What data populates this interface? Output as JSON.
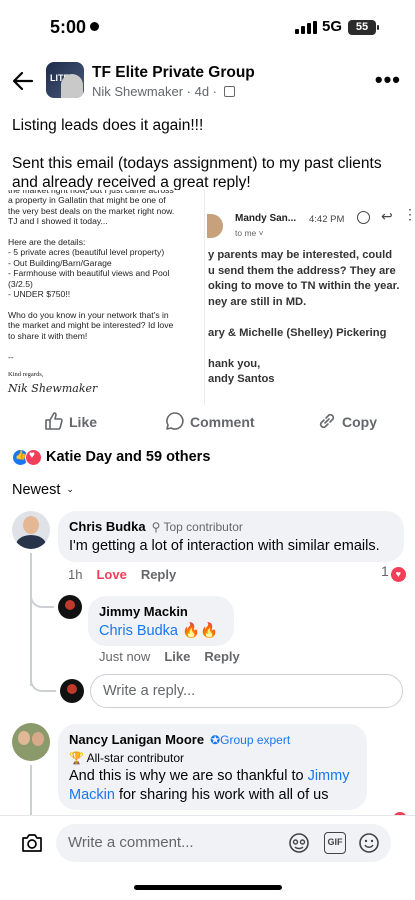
{
  "status_bar": {
    "time": "5:00",
    "network": "5G",
    "battery": "55"
  },
  "header": {
    "group_name": "TF Elite Private Group",
    "author": "Nik Shewmaker",
    "age": "4d",
    "avatar_text": "LITE"
  },
  "post": {
    "line1": "Listing leads does it again!!!",
    "line2": "Sent this email (todays assignment) to my past clients and already received a great reply!"
  },
  "email_left": {
    "lines": [
      "the market right now, but I just came across",
      "a property in Gallatin that might be one of",
      "the very best deals on the market right now.",
      "TJ and I showed it today...",
      "",
      "Here are the details:",
      "- 5 private acres (beautiful level property)",
      "- Out Building/Barn/Garage",
      "- Farmhouse with beautiful views and Pool",
      "(3/2.5)",
      "- UNDER $750!!",
      "",
      "Who do you know in your network that's in",
      "the market and might be interested? Id love",
      "to share it with them!",
      "",
      "--"
    ],
    "closing": "Kind regards,",
    "signature": "Nik Shewmaker"
  },
  "email_right": {
    "sender": "Mandy San...",
    "time": "4:42 PM",
    "to": "to me",
    "lines": [
      "y parents may be interested, could",
      "u send them the address? They are",
      "oking to move to TN within the year.",
      "ney are still in MD.",
      "",
      "ary & Michelle (Shelley) Pickering",
      "",
      "hank you,",
      "andy Santos"
    ]
  },
  "actions": {
    "like": "Like",
    "comment": "Comment",
    "copy": "Copy"
  },
  "reactions": {
    "text": "Katie Day and 59 others"
  },
  "sort": {
    "label": "Newest"
  },
  "comments": [
    {
      "name": "Chris Budka",
      "badge": "Top contributor",
      "text": "I'm getting a lot of interaction with similar emails.",
      "time": "1h",
      "love": "Love",
      "reply": "Reply",
      "reaction_count": "1"
    },
    {
      "name": "Jimmy Mackin",
      "mention": "Chris Budka",
      "emoji": "🔥🔥",
      "time": "Just now",
      "like": "Like",
      "reply": "Reply"
    },
    {
      "name": "Nancy Lanigan Moore",
      "badge": "Group expert",
      "badge2": "All-star contributor",
      "text_before": "And this is why we are so thankful to ",
      "mention": "Jimmy Mackin",
      "text_after": " for sharing his work with all of us"
    }
  ],
  "reply_input": {
    "placeholder": "Write a reply..."
  },
  "composer": {
    "placeholder": "Write a comment...",
    "gif": "GIF"
  }
}
